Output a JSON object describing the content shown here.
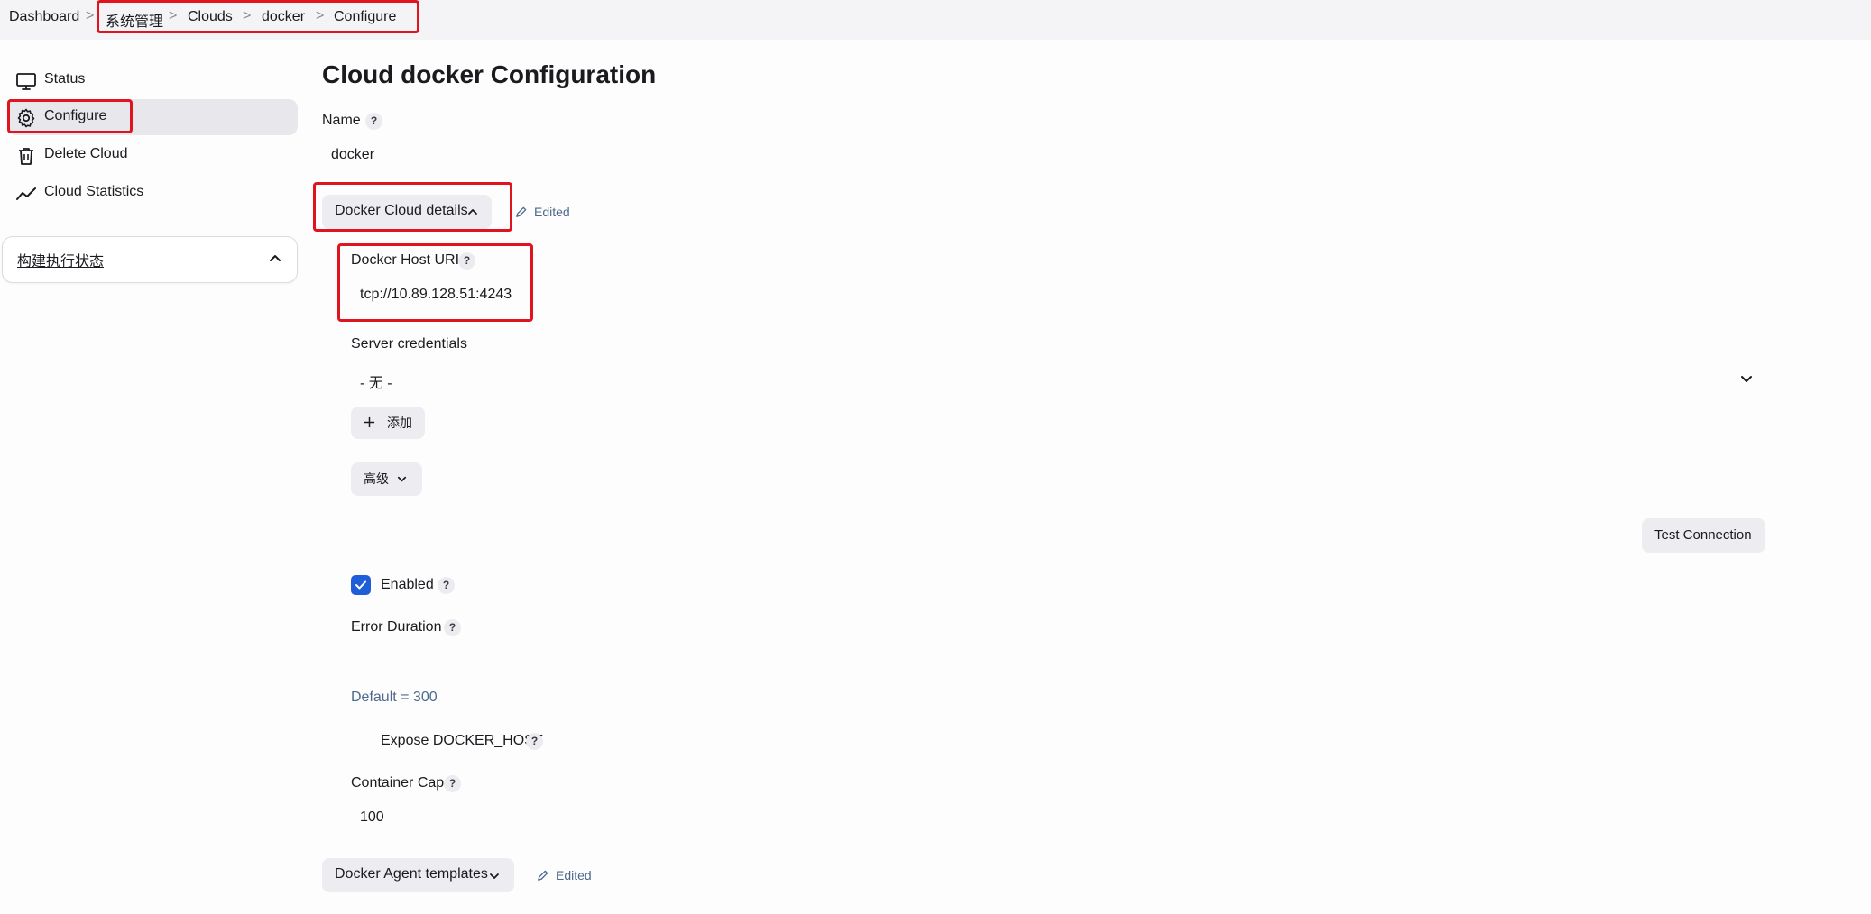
{
  "breadcrumb": {
    "items": [
      "Dashboard",
      "系统管理",
      "Clouds",
      "docker",
      "Configure"
    ],
    "separator": ">"
  },
  "sidebar": {
    "items": [
      {
        "label": "Status",
        "icon": "monitor-icon"
      },
      {
        "label": "Configure",
        "icon": "gear-icon"
      },
      {
        "label": "Delete Cloud",
        "icon": "trash-icon"
      },
      {
        "label": "Cloud Statistics",
        "icon": "trend-line-icon"
      }
    ],
    "panel_title": "构建执行状态"
  },
  "main": {
    "title": "Cloud docker Configuration",
    "name_label": "Name",
    "name_value": "docker",
    "docker_cloud_details_button": "Docker Cloud details",
    "edited_label": "Edited",
    "docker_host_uri_label": "Docker Host URI",
    "docker_host_uri_value": "tcp://10.89.128.51:4243",
    "server_credentials_label": "Server credentials",
    "server_credentials_value": "- 无 -",
    "add_button": "添加",
    "advanced_button": "高级",
    "test_connection_button": "Test Connection",
    "enabled_label": "Enabled",
    "enabled_checked": true,
    "error_duration_label": "Error Duration",
    "error_duration_default": "Default = 300",
    "expose_docker_host_label": "Expose DOCKER_HOST",
    "container_cap_label": "Container Cap",
    "container_cap_value": "100",
    "agent_templates_button": "Docker Agent templates",
    "agent_templates_edited": "Edited",
    "help_glyph": "?"
  },
  "colors": {
    "highlight_box": "#e0141e",
    "accent_blue": "#1e5ed6",
    "link_blue": "#4d6a8c"
  }
}
